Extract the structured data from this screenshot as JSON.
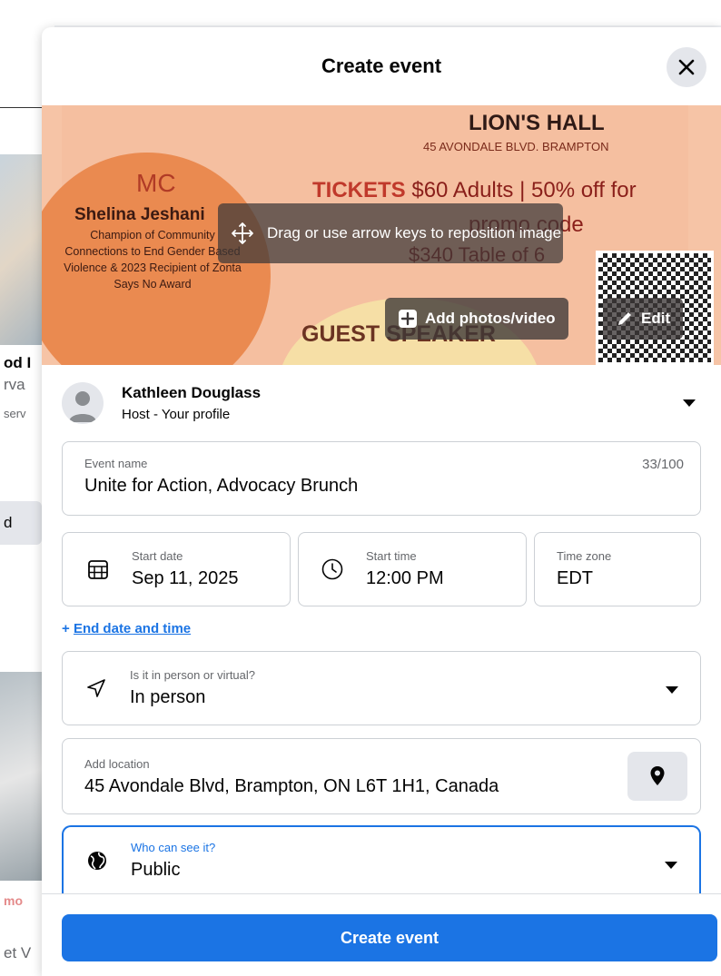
{
  "background": {
    "fragments": [
      "od I",
      "rva",
      "serv",
      "d",
      "mo",
      "et V"
    ]
  },
  "modal": {
    "title": "Create event",
    "close_icon": "close-icon"
  },
  "banner": {
    "poster": {
      "mc_heading": "MC",
      "mc_name": "Shelina Jeshani",
      "mc_description": "Champion of Community Connections to End Gender Based Violence & 2023 Recipient of Zonta Says No Award",
      "venue": "LION'S HALL",
      "address": "45 AVONDALE BLVD. BRAMPTON",
      "tickets_label": "TICKETS",
      "tickets_text": "$60 Adults | 50% off for",
      "promo_text": "promo code",
      "table_text": "$340 Table of 6",
      "guest_speaker": "GUEST SPEAKER"
    },
    "drag_hint": "Drag or use arrow keys to reposition image",
    "add_photos_label": "Add photos/video",
    "edit_label": "Edit"
  },
  "host": {
    "name": "Kathleen Douglass",
    "subtitle": "Host - Your profile"
  },
  "event_name": {
    "label": "Event name",
    "value": "Unite for Action, Advocacy Brunch",
    "counter": "33/100"
  },
  "start_date": {
    "label": "Start date",
    "value": "Sep 11, 2025"
  },
  "start_time": {
    "label": "Start time",
    "value": "12:00 PM"
  },
  "time_zone": {
    "label": "Time zone",
    "value": "EDT"
  },
  "end_link": {
    "prefix": "+",
    "label": "End date and time"
  },
  "mode": {
    "label": "Is it in person or virtual?",
    "value": "In person"
  },
  "location": {
    "label": "Add location",
    "value": "45 Avondale Blvd, Brampton, ON L6T 1H1, Canada"
  },
  "privacy": {
    "label": "Who can see it?",
    "value": "Public"
  },
  "footer": {
    "create_label": "Create event"
  },
  "colors": {
    "primary": "#1b74e4",
    "surface": "#ffffff",
    "border": "#ccd0d5",
    "muted_text": "#65676b"
  }
}
